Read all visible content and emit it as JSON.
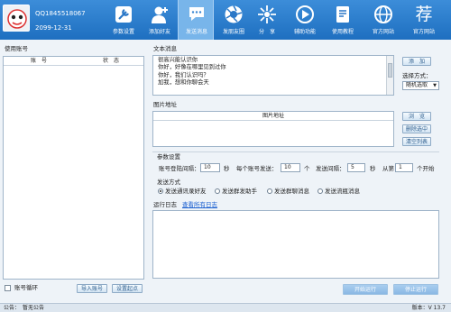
{
  "header": {
    "account": "QQ1845518067",
    "date": "2099-12-31",
    "nav": [
      {
        "label": "参数设置",
        "icon": "wrench-icon"
      },
      {
        "label": "添加好友",
        "icon": "add-user-icon"
      },
      {
        "label": "发送消息",
        "icon": "chat-icon"
      },
      {
        "label": "发朋友圈",
        "icon": "camera-aperture-icon"
      },
      {
        "label": "分　享",
        "icon": "share-icon"
      },
      {
        "label": "辅助功能",
        "icon": "globe-arrow-icon"
      },
      {
        "label": "使用教程",
        "icon": "document-icon"
      },
      {
        "label": "官方网站",
        "icon": "ie-icon"
      },
      {
        "label": "官方网站",
        "icon": "jian-icon"
      }
    ],
    "jian_glyph": "荐"
  },
  "left": {
    "title": "使用账号",
    "col_account": "账　号",
    "col_status": "状　态",
    "loop_label": "账号循环",
    "import_button": "导入账号",
    "setup_button": "设置起点"
  },
  "text_msg": {
    "title": "文本消息",
    "lines": [
      "很高兴能认识你",
      "你好，好像在哪里见到过你",
      "你好，我们认识吗？",
      "加我，想和你聊会天"
    ],
    "add_button": "添　加",
    "select_mode_label": "选择方式：",
    "select_mode_value": "随机选取"
  },
  "images": {
    "title": "图片地址",
    "col": "图片地址",
    "browse_button": "浏　览",
    "delete_button": "删除选中",
    "clear_button": "清空列表"
  },
  "params": {
    "title": "参数设置",
    "switch_label": "账号登陆间隔：",
    "switch_value": "10",
    "sec1": "秒",
    "per_account_label": "每个账号发送：",
    "per_account_value": "10",
    "unit": "个",
    "interval_label": "发送间隔：",
    "interval_value": "5",
    "sec2": "秒",
    "from_label": "从第",
    "from_value": "1",
    "start_label": "个开始"
  },
  "send_mode": {
    "title": "发送方式",
    "options": [
      "发送通讯录好友",
      "发送群发助手",
      "发送群聊消息",
      "发送流瓶消息"
    ],
    "selected": 0
  },
  "log": {
    "title": "运行日志",
    "link": "查看所有日志"
  },
  "actions": {
    "start": "开始运行",
    "stop": "停止运行"
  },
  "status": {
    "notice": "公告：　暂无公告",
    "version": "版本：V 13.7"
  }
}
